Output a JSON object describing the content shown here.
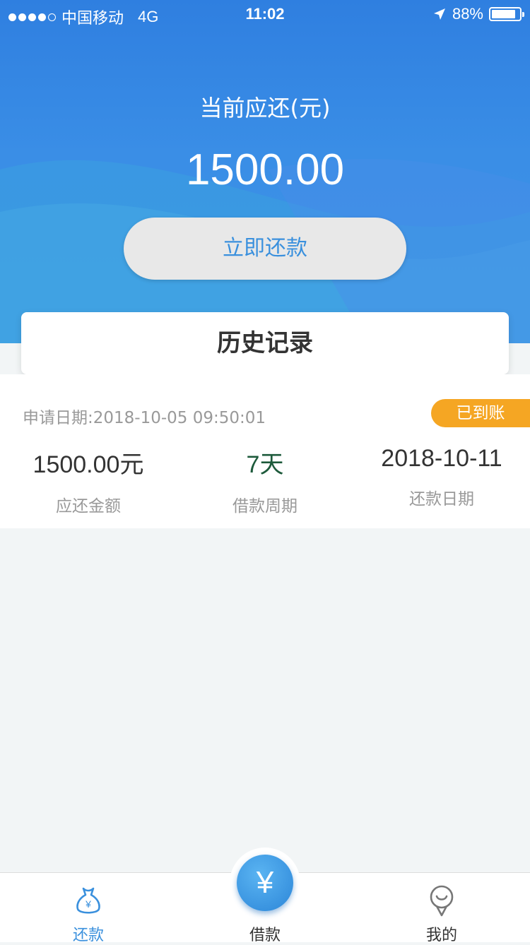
{
  "status_bar": {
    "carrier": "中国移动",
    "network": "4G",
    "time": "11:02",
    "battery": "88%",
    "location_icon": "location-arrow-icon"
  },
  "hero": {
    "due_label": "当前应还(元)",
    "due_amount": "1500.00",
    "pay_button": "立即还款"
  },
  "history": {
    "title": "历史记录",
    "record": {
      "apply_date": "申请日期:2018-10-05 09:50:01",
      "status": "已到账",
      "amount_value": "1500.00元",
      "amount_label": "应还金额",
      "period_value": "7天",
      "period_label": "借款周期",
      "repay_date_value": "2018-10-11",
      "repay_date_label": "还款日期"
    }
  },
  "tabbar": {
    "repay_label": "还款",
    "borrow_label": "借款",
    "borrow_icon_glyph": "¥",
    "mine_label": "我的"
  },
  "colors": {
    "brand_blue": "#3a90dd",
    "badge_orange": "#f5a623"
  }
}
